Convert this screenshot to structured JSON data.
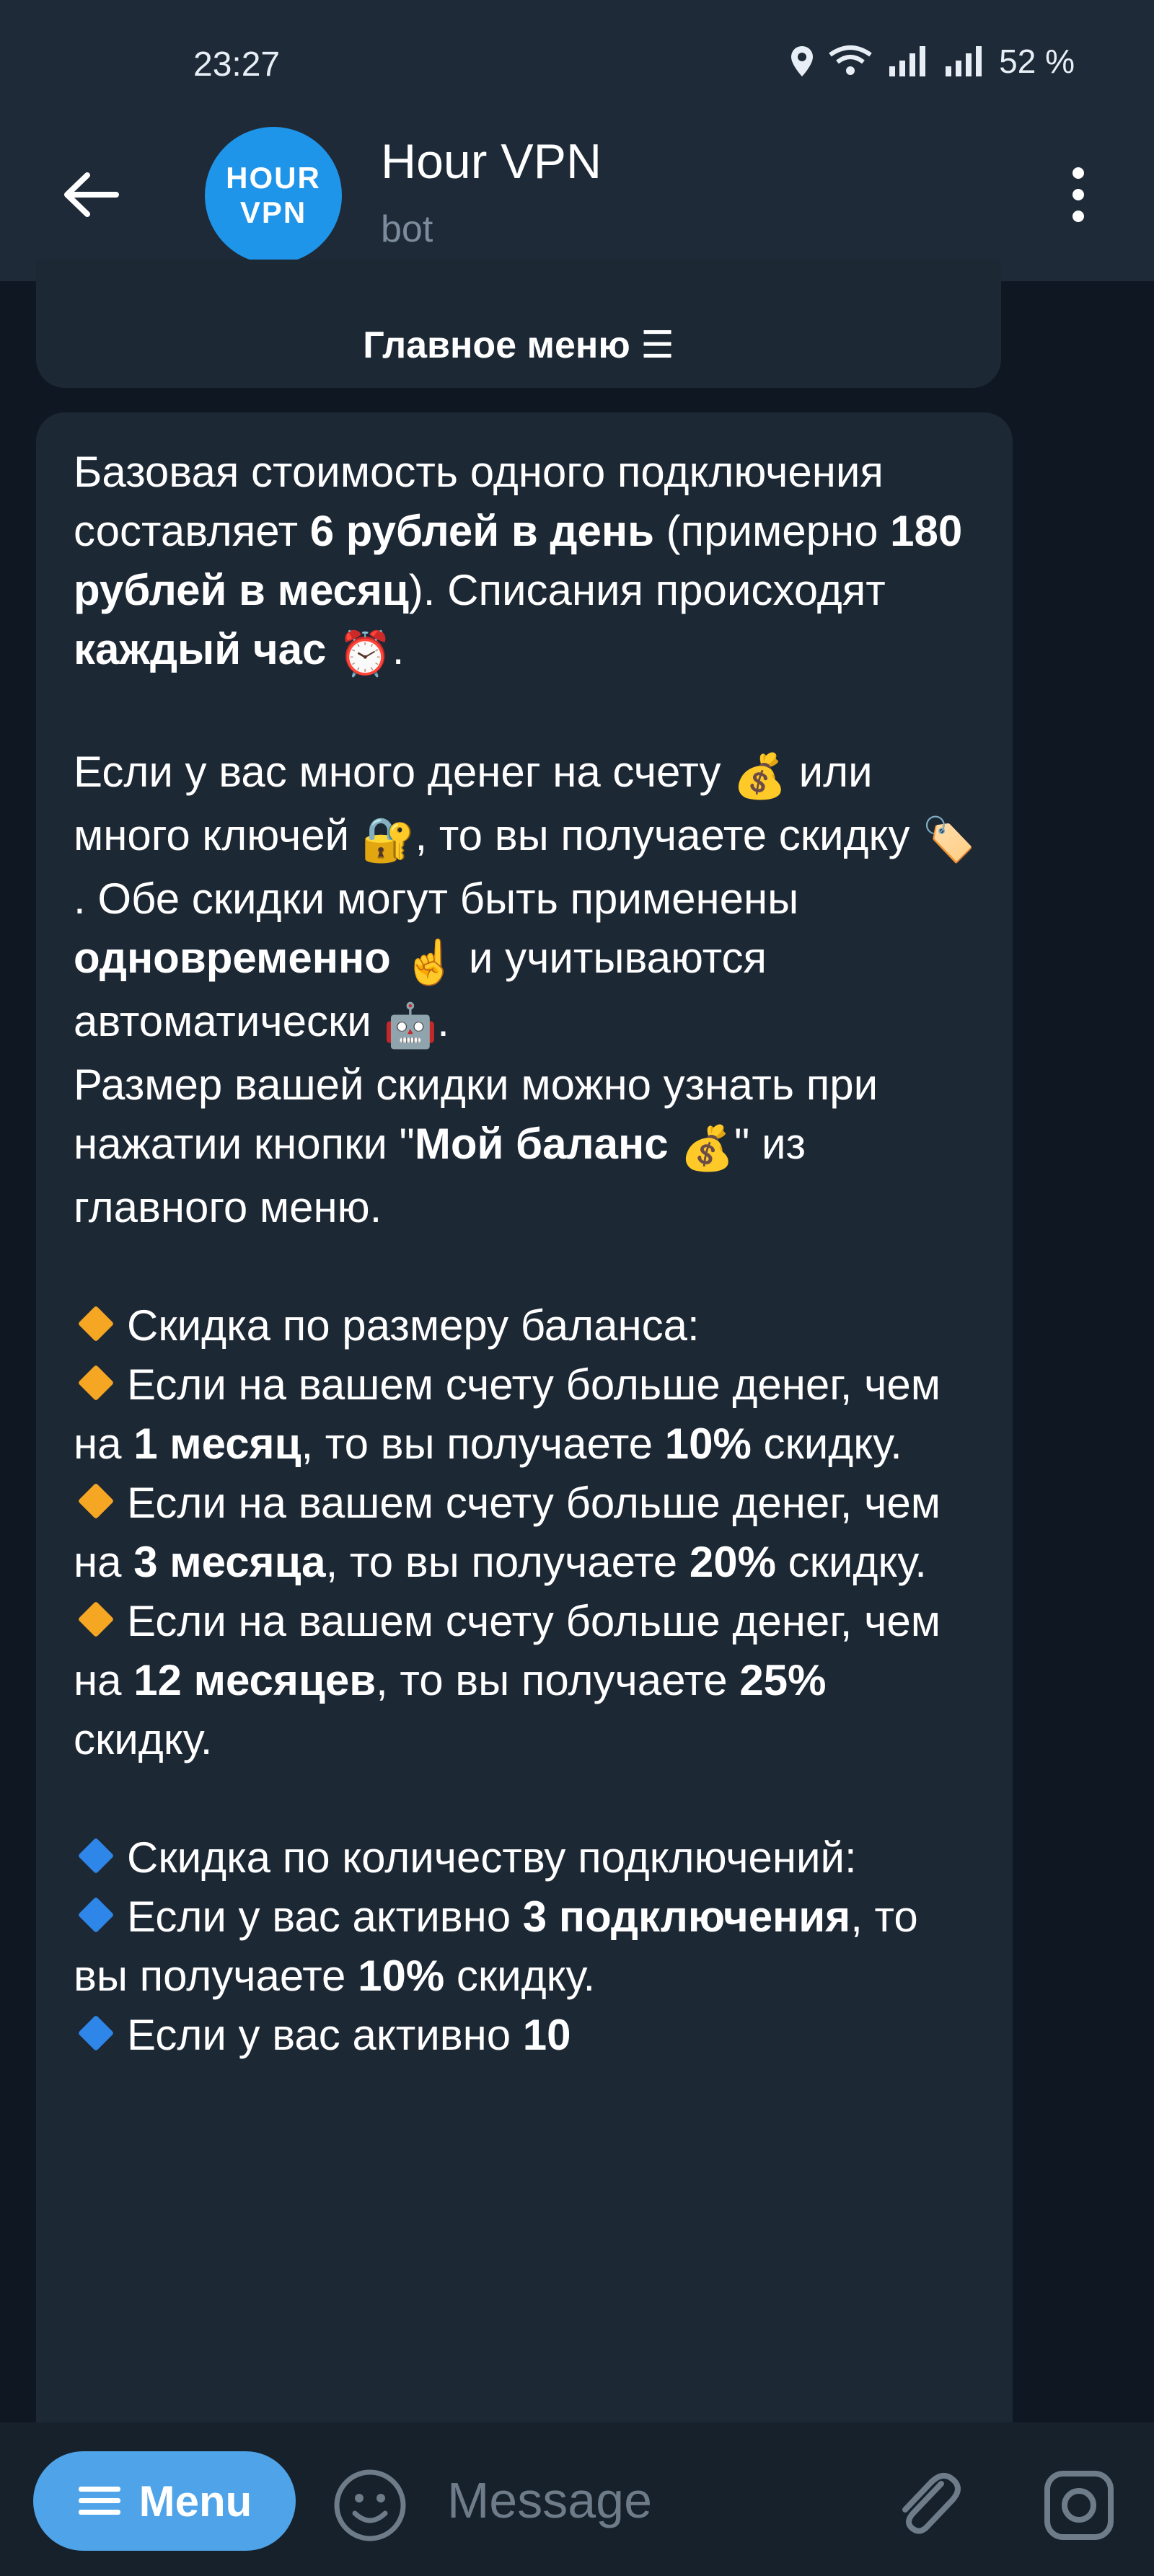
{
  "status": {
    "time": "23:27",
    "battery": "52 %",
    "icons": [
      "location-icon",
      "wifi-icon",
      "signal-icon",
      "signal-icon"
    ]
  },
  "header": {
    "title": "Hour VPN",
    "subtitle": "bot",
    "avatar_line1": "HOUR",
    "avatar_line2": "VPN",
    "avatar_color": "#1e95e8"
  },
  "main_menu_button": "Главное меню ☰",
  "message": {
    "p1_a": "Базовая стоимость одного подключения составляет ",
    "p1_b": "6 рублей в день",
    "p1_c": " (примерно ",
    "p1_d": "180 рублей в месяц",
    "p1_e": "). Списания происходят ",
    "p1_f": "каждый час",
    "p1_emoji": "⏰",
    "p1_end": ".",
    "p2_a": "Если у вас много денег на счету ",
    "p2_money1": "💰",
    "p2_b": " или много ключей ",
    "p2_key": "🔐",
    "p2_c": ", то вы получаете скидку ",
    "p2_tag": "🏷️",
    "p2_d": ". Обе скидки могут быть применены ",
    "p2_e": "одновременно",
    "p2_finger": "☝️",
    "p2_f": " и учитываются автоматически ",
    "p2_robot": "🤖",
    "p2_end": ".",
    "p3_a": "Размер вашей скидки можно узнать при нажатии кнопки \"",
    "p3_b": "Мой баланс",
    "p3_money": "💰",
    "p3_c": "\" из главного меню.",
    "balance_title": "Скидка по размеру баланса:",
    "bal1_a": "Если на вашем счету больше денег, чем на ",
    "bal1_b": "1 месяц",
    "bal1_c": ", то вы получаете ",
    "bal1_d": "10%",
    "bal1_e": " скидку.",
    "bal2_a": "Если на вашем счету больше денег, чем на ",
    "bal2_b": "3 месяца",
    "bal2_c": ", то вы получаете ",
    "bal2_d": "20%",
    "bal2_e": " скидку.",
    "bal3_a": "Если на вашем счету больше денег, чем на ",
    "bal3_b": "12 месяцев",
    "bal3_c": ", то вы получаете ",
    "bal3_d": "25%",
    "bal3_e": " скидку.",
    "conn_title": "Скидка по количеству подключений:",
    "conn1_a": "Если у вас активно ",
    "conn1_b": "3 подключения",
    "conn1_c": ", то вы получаете ",
    "conn1_d": "10%",
    "conn1_e": " скидку.",
    "conn2_a": "Если у вас активно ",
    "conn2_b": "10"
  },
  "input": {
    "menu_label": "Menu",
    "placeholder": "Message"
  },
  "colors": {
    "background": "#0e1621",
    "bubble": "#1d2835",
    "header": "#1e2a38",
    "accent": "#4fa3e8",
    "orange_diamond": "#f5a623",
    "blue_diamond": "#2e86e8"
  }
}
